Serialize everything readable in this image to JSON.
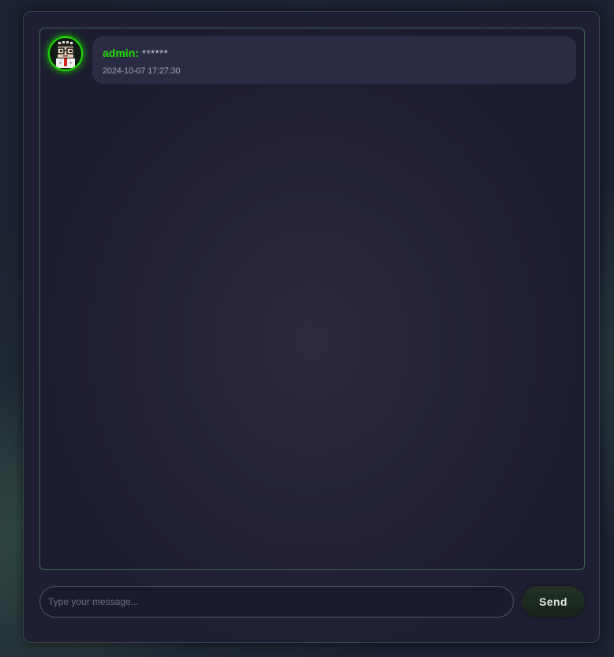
{
  "chat": {
    "messages": [
      {
        "username": "admin:",
        "text": "******",
        "timestamp": "2024-10-07 17:27:30",
        "avatar_icon": "pixel-avatar-icon"
      }
    ]
  },
  "composer": {
    "placeholder": "Type your message...",
    "value": "",
    "send_label": "Send"
  },
  "colors": {
    "accent": "#1fe000",
    "background": "#1f2034",
    "bubble": "#2c2b44",
    "border": "#5fa073"
  }
}
